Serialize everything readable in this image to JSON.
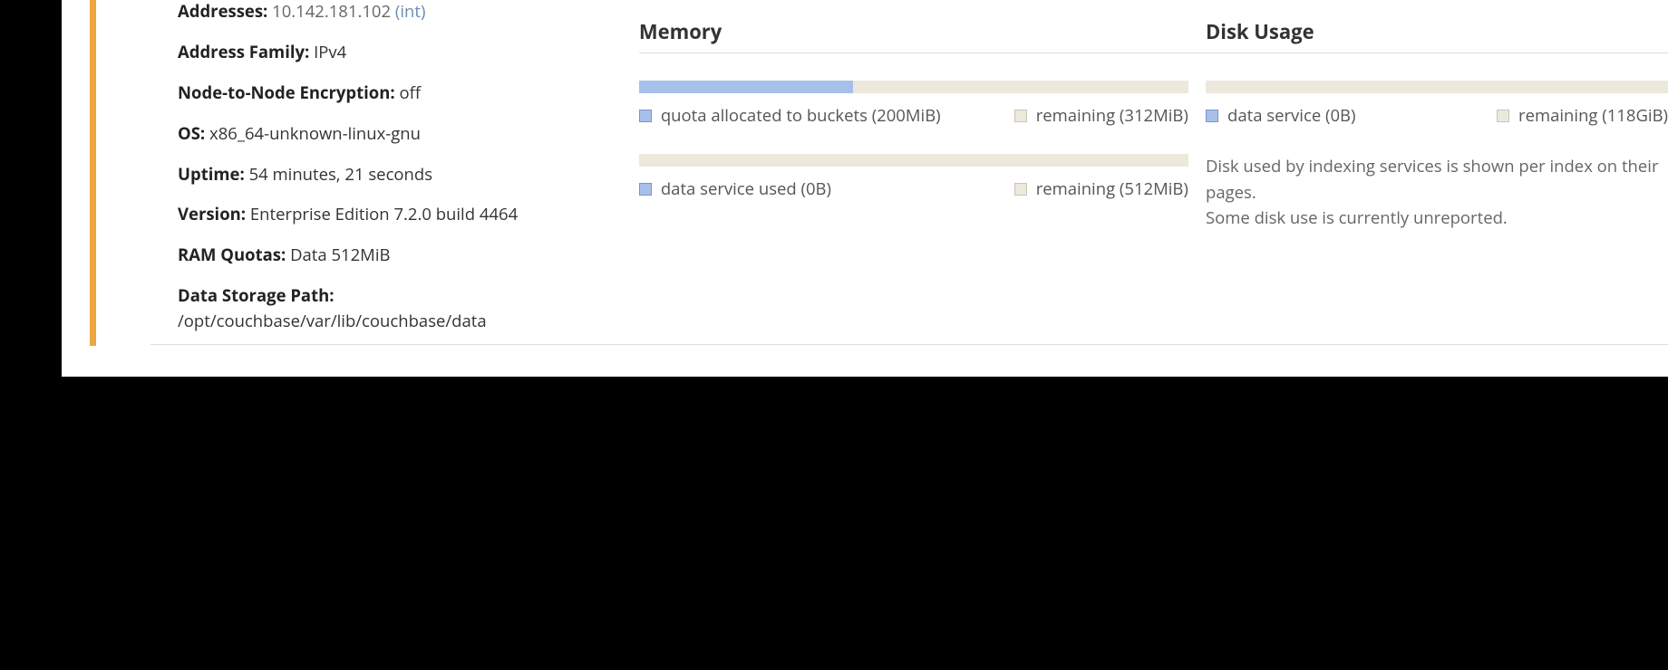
{
  "node_info": {
    "addresses_label": "Addresses:",
    "addresses_ip": "10.142.181.102",
    "addresses_tag": "(int)",
    "address_family_label": "Address Family:",
    "address_family_value": "IPv4",
    "encryption_label": "Node-to-Node Encryption:",
    "encryption_value": "off",
    "os_label": "OS:",
    "os_value": "x86_64-unknown-linux-gnu",
    "uptime_label": "Uptime:",
    "uptime_value": "54 minutes, 21 seconds",
    "version_label": "Version:",
    "version_value": "Enterprise Edition 7.2.0 build 4464",
    "ram_quotas_label": "RAM Quotas:",
    "ram_quotas_value": "Data 512MiB",
    "storage_path_label": "Data Storage Path:",
    "storage_path_value": "/opt/couchbase/var/lib/couchbase/data"
  },
  "memory": {
    "title": "Memory",
    "bar1_fill_pct": 39,
    "bar1_legend_used": "quota allocated to buckets (200MiB)",
    "bar1_legend_remaining": "remaining (312MiB)",
    "bar2_fill_pct": 0,
    "bar2_legend_used": "data service used (0B)",
    "bar2_legend_remaining": "remaining (512MiB)"
  },
  "disk": {
    "title": "Disk Usage",
    "bar_fill_pct": 0,
    "legend_used": "data service (0B)",
    "legend_remaining": "remaining (118GiB)",
    "note_line1": "Disk used by indexing services is shown per index on their pages.",
    "note_line2": "Some disk use is currently unreported."
  },
  "chart_data": [
    {
      "type": "bar",
      "title": "Memory — quota allocated to buckets",
      "categories": [
        "quota allocated to buckets",
        "remaining"
      ],
      "values_mib": [
        200,
        312
      ],
      "total_mib": 512
    },
    {
      "type": "bar",
      "title": "Memory — data service used",
      "categories": [
        "data service used",
        "remaining"
      ],
      "values_mib": [
        0,
        512
      ],
      "total_mib": 512
    },
    {
      "type": "bar",
      "title": "Disk Usage — data service",
      "categories": [
        "data service",
        "remaining"
      ],
      "values_gib": [
        0,
        118
      ],
      "total_gib": 118
    }
  ]
}
